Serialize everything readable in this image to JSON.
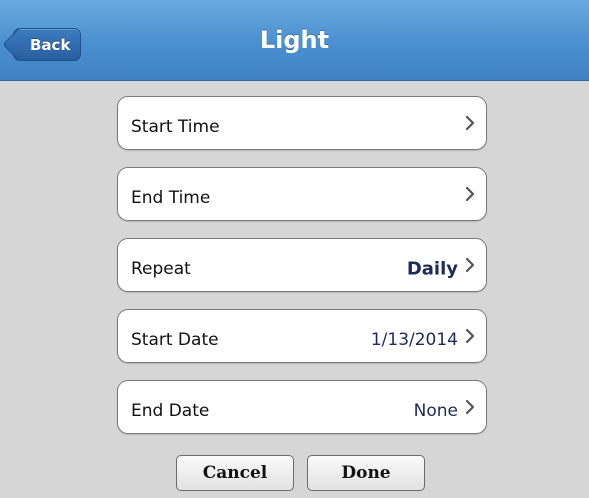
{
  "header": {
    "title": "Light",
    "back_label": "Back"
  },
  "rows": [
    {
      "label": "Start Time",
      "value": ""
    },
    {
      "label": "End Time",
      "value": ""
    },
    {
      "label": "Repeat",
      "value": "Daily"
    },
    {
      "label": "Start Date",
      "value": "1/13/2014"
    },
    {
      "label": "End Date",
      "value": "None"
    }
  ],
  "actions": {
    "cancel_label": "Cancel",
    "done_label": "Done"
  },
  "colors": {
    "header_blue": "#4a8fcf",
    "background": "#d6d6d6",
    "value_text": "#1e2a5a"
  },
  "icons": {
    "row_disclosure": "chevron-right-icon",
    "back": "back-arrow-icon"
  }
}
